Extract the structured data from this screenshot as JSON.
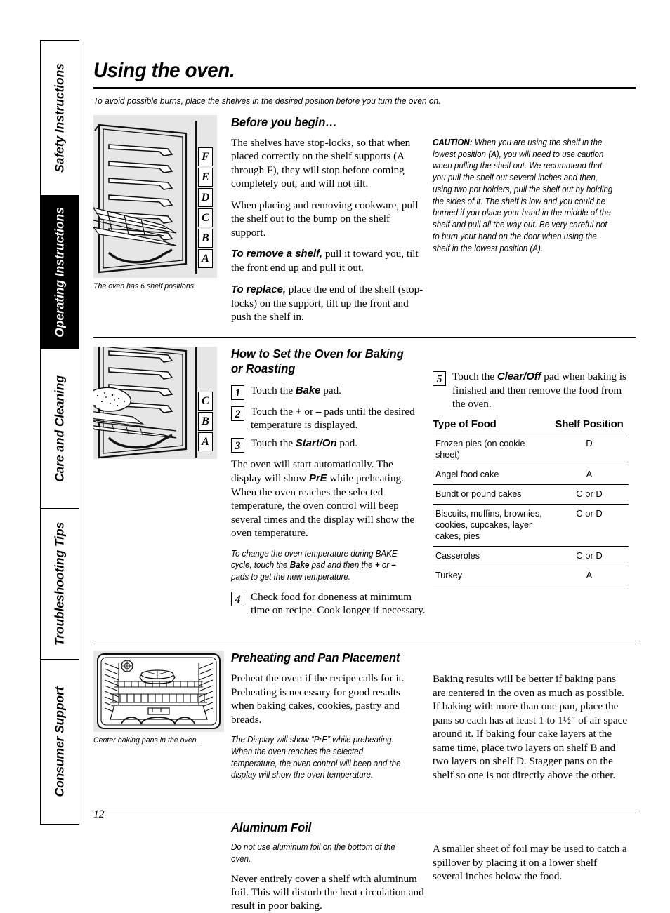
{
  "sidebar": {
    "tabs": [
      {
        "label": "Safety Instructions",
        "active": false
      },
      {
        "label": "Operating Instructions",
        "active": true
      },
      {
        "label": "Care and Cleaning",
        "active": false
      },
      {
        "label": "Troubleshooting Tips",
        "active": false
      },
      {
        "label": "Consumer Support",
        "active": false
      }
    ]
  },
  "header": {
    "title": "Using the oven.",
    "subtitle": "To avoid possible burns, place the shelves in the desired position before you turn the oven on."
  },
  "before_you_begin": {
    "heading": "Before you begin…",
    "paragraph1": "The shelves have stop-locks, so that when placed correctly on the shelf supports (A through F), they will stop before coming completely out, and will not tilt.",
    "paragraph2": "When placing and removing cookware, pull the shelf out to the bump on the shelf support.",
    "remove_label": "To remove a shelf,",
    "remove_text": " pull it toward you, tilt the front end up and pull it out.",
    "replace_label": "To replace,",
    "replace_text": " place the end of the shelf (stop-locks) on the support, tilt up the front and push the shelf in.",
    "caution_label": "CAUTION:",
    "caution_text": " When you are using the shelf in the lowest position (A), you will need to use caution when pulling the shelf out. We recommend that you pull the shelf out several inches and then, using two pot holders, pull the shelf out by holding the sides of it. The shelf is low and you could be burned if you place your hand in the middle of the shelf and pull all the way out. Be very careful not to burn your hand on the door when using the shelf in the lowest position (A).",
    "art_caption": "The oven has 6 shelf positions.",
    "shelf_letters": [
      "F",
      "E",
      "D",
      "C",
      "B",
      "A"
    ]
  },
  "baking": {
    "heading": "How to Set the Oven for Baking or Roasting",
    "steps": [
      {
        "num": "1",
        "html": "Touch the <b class=\"bold-sans\">Bake</b> pad."
      },
      {
        "num": "2",
        "html": "Touch the <b>+</b> or <b>–</b> pads until the desired temperature is displayed."
      },
      {
        "num": "3",
        "html": "Touch the <b class=\"bold-sans\">Start/On</b> pad."
      },
      {
        "num": "4",
        "html": "Check food for doneness at minimum time on recipe. Cook longer if necessary."
      },
      {
        "num": "5",
        "html": "Touch the <b class=\"bold-sans\">Clear/Off</b> pad when baking is finished and then remove the food from the oven."
      }
    ],
    "body_after_step3_a": "The oven will start automatically. The display will show ",
    "body_after_step3_pre": "PrE",
    "body_after_step3_b": " while preheating. When the oven reaches the selected temperature, the oven control will beep several times and the display will show the oven temperature.",
    "note_a": "To change the oven temperature during BAKE cycle, touch the ",
    "note_bake": "Bake",
    "note_b": " pad and then the ",
    "note_plus": "+",
    "note_c": " or ",
    "note_minus": "–",
    "note_d": " pads to get the new temperature.",
    "shelf_letters": [
      "C",
      "B",
      "A"
    ],
    "table": {
      "columns": [
        "Type of Food",
        "Shelf Position"
      ],
      "rows": [
        {
          "food": "Frozen pies (on cookie sheet)",
          "position": "D"
        },
        {
          "food": "Angel food cake",
          "position": "A"
        },
        {
          "food": "Bundt or pound cakes",
          "position": "C or D"
        },
        {
          "food": "Biscuits, muffins, brownies, cookies, cupcakes, layer cakes, pies",
          "position": "C or D"
        },
        {
          "food": "Casseroles",
          "position": "C or D"
        },
        {
          "food": "Turkey",
          "position": "A"
        }
      ]
    }
  },
  "preheating": {
    "heading": "Preheating and Pan Placement",
    "paragraph1": "Preheat the oven if the recipe calls for it. Preheating is necessary for good results when baking cakes, cookies, pastry and breads.",
    "note": "The Display will show “PrE” while preheating. When the oven reaches the selected temperature, the oven control will beep and the display will show the oven temperature.",
    "right_paragraph": "Baking results will be better if baking pans are centered in the oven as much as possible. If baking with more than one pan, place the pans so each has at least 1 to 1½″ of air space around it. If baking four cake layers at the same time, place two layers on shelf B and two layers on shelf D. Stagger pans on the shelf so one is not directly above the other.",
    "art_caption": "Center baking pans in the oven."
  },
  "aluminum_foil": {
    "heading": "Aluminum Foil",
    "note": "Do not use aluminum foil on the bottom of the oven.",
    "paragraph": "Never entirely cover a shelf with aluminum foil. This will disturb the heat circulation and result in poor baking.",
    "right_paragraph": "A smaller sheet of foil may be used to catch a spillover by placing it on a lower shelf several inches below the food."
  },
  "footer": {
    "page_number": "12"
  }
}
